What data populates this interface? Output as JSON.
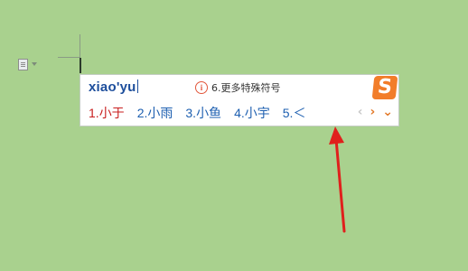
{
  "ime": {
    "pinyin": "xiao'yu",
    "hint_text": "6.更多特殊符号",
    "logo_glyph": "S",
    "candidates": [
      {
        "index": "1.",
        "text": "小于"
      },
      {
        "index": "2.",
        "text": "小雨"
      },
      {
        "index": "3.",
        "text": "小鱼"
      },
      {
        "index": "4.",
        "text": "小宇"
      },
      {
        "index": "5.",
        "text": "＜"
      }
    ],
    "pager": {
      "prev": "‹",
      "next": "›",
      "more": "⌄"
    }
  },
  "colors": {
    "background": "#a9d18e",
    "accent_orange": "#f27d2a",
    "selected_candidate": "#c81d1d",
    "candidate": "#1d5fb0",
    "annotation_arrow": "#e0201c"
  },
  "icons": {
    "paste": "paste-options-icon",
    "hint": "info-icon",
    "logo": "sogou-logo-icon"
  }
}
